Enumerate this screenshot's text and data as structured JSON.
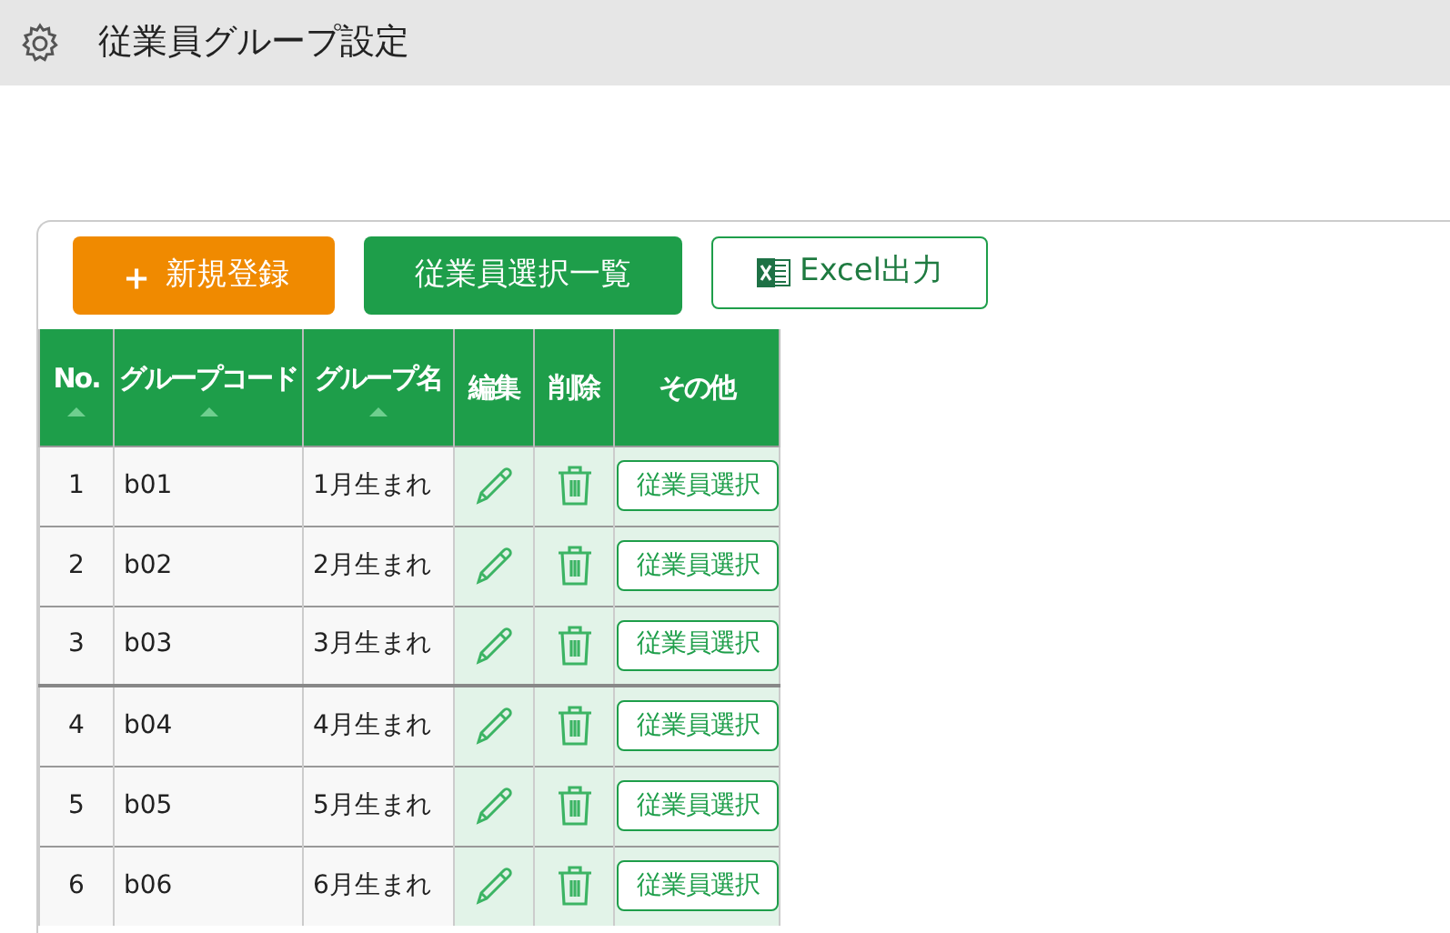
{
  "header": {
    "title": "従業員グループ設定"
  },
  "toolbar": [
    {
      "kind": "add",
      "label": "新規登録",
      "icon": "＋"
    },
    {
      "kind": "primary",
      "label": "従業員選択一覧"
    },
    {
      "kind": "excel",
      "label": "Excel出力"
    }
  ],
  "table": {
    "columns": [
      {
        "label": "No.",
        "sortable": true
      },
      {
        "label": "グループコード",
        "sortable": true
      },
      {
        "label": "グループ名",
        "sortable": true
      },
      {
        "label": "編集",
        "sortable": false
      },
      {
        "label": "削除",
        "sortable": false
      },
      {
        "label": "その他",
        "sortable": false
      }
    ],
    "rows": [
      {
        "no": "1",
        "code": "b01",
        "name": "1月生まれ",
        "action": "従業員選択"
      },
      {
        "no": "2",
        "code": "b02",
        "name": "2月生まれ",
        "action": "従業員選択"
      },
      {
        "no": "3",
        "code": "b03",
        "name": "3月生まれ",
        "action": "従業員選択"
      },
      {
        "no": "4",
        "code": "b04",
        "name": "4月生まれ",
        "action": "従業員選択"
      },
      {
        "no": "5",
        "code": "b05",
        "name": "5月生まれ",
        "action": "従業員選択"
      },
      {
        "no": "6",
        "code": "b06",
        "name": "6月生まれ",
        "action": "従業員選択"
      }
    ]
  }
}
